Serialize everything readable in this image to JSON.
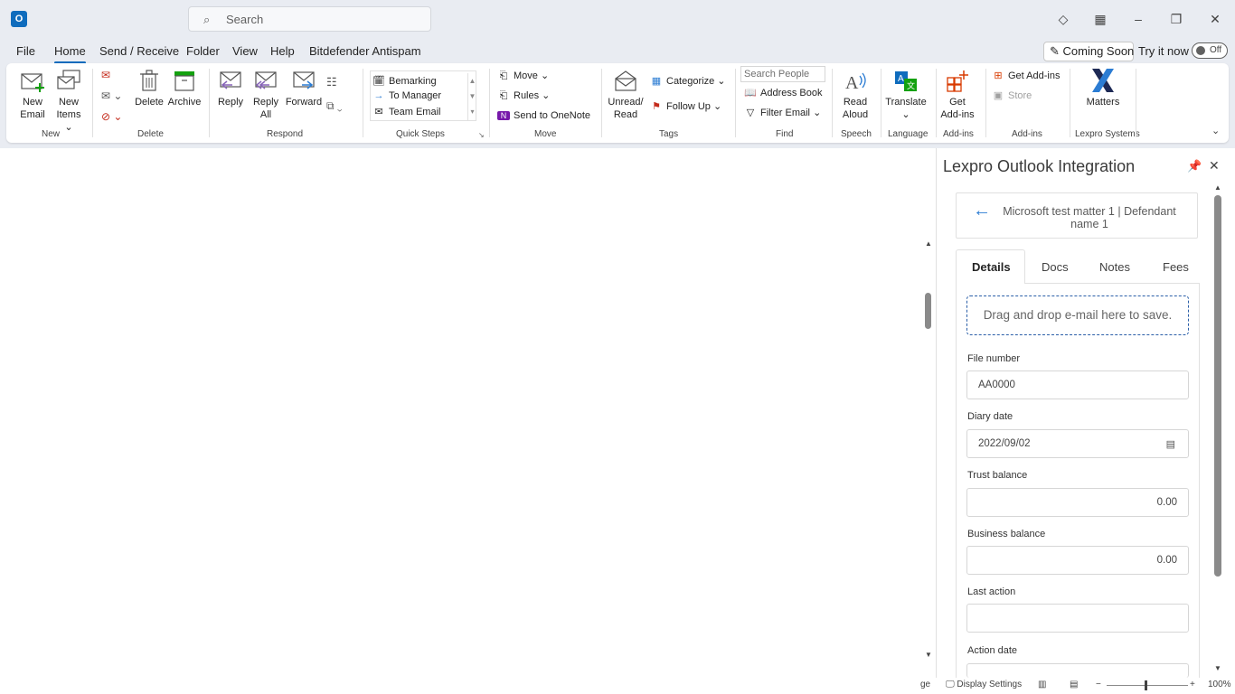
{
  "titlebar": {
    "app_icon": "outlook-icon",
    "search_placeholder": "Search"
  },
  "menu": {
    "tabs": [
      "File",
      "Home",
      "Send / Receive",
      "Folder",
      "View",
      "Help",
      "Bitdefender Antispam"
    ],
    "active": "Home",
    "coming_soon": "Coming Soon",
    "try_it_now": "Try it now",
    "toggle_state": "Off"
  },
  "ribbon": {
    "new_email": [
      "New",
      "Email"
    ],
    "new_items": [
      "New",
      "Items"
    ],
    "delete": "Delete",
    "archive": "Archive",
    "reply": "Reply",
    "reply_all": [
      "Reply",
      "All"
    ],
    "forward": "Forward",
    "quick_steps": [
      "Bemarking",
      "To Manager",
      "Team Email"
    ],
    "move": "Move",
    "rules": "Rules",
    "send_onenote": "Send to OneNote",
    "unread_read": [
      "Unread/",
      "Read"
    ],
    "categorize": "Categorize",
    "follow_up": "Follow Up",
    "search_people_placeholder": "Search People",
    "address_book": "Address Book",
    "filter_email": "Filter Email",
    "read_aloud": [
      "Read",
      "Aloud"
    ],
    "translate": "Translate",
    "get_addins": [
      "Get",
      "Add-ins"
    ],
    "get_addins_small": "Get Add-ins",
    "store": "Store",
    "matters": "Matters",
    "groups": {
      "new": "New",
      "delete": "Delete",
      "respond": "Respond",
      "quick_steps": "Quick Steps",
      "move": "Move",
      "tags": "Tags",
      "find": "Find",
      "speech": "Speech",
      "language": "Language",
      "addins": "Add-ins",
      "addins2": "Add-ins",
      "lexpro": "Lexpro Systems"
    }
  },
  "addin": {
    "title": "Lexpro Outlook Integration",
    "matter": "Microsoft test matter 1 | Defendant name 1",
    "tabs": [
      "Details",
      "Docs",
      "Notes",
      "Fees"
    ],
    "dropzone": "Drag and drop e-mail here to save.",
    "fields": {
      "file_number_label": "File number",
      "file_number": "AA0000",
      "diary_date_label": "Diary date",
      "diary_date": "2022/09/02",
      "trust_balance_label": "Trust balance",
      "trust_balance": "0.00",
      "business_balance_label": "Business balance",
      "business_balance": "0.00",
      "last_action_label": "Last action",
      "last_action": "",
      "action_date_label": "Action date"
    }
  },
  "statusbar": {
    "left_fragment": "ge",
    "display_settings": "Display Settings",
    "zoom": "100%"
  },
  "colors": {
    "accent": "#0f6cbd",
    "dropzone_border": "#2b5fa8",
    "back_arrow": "#2b7cd3"
  }
}
